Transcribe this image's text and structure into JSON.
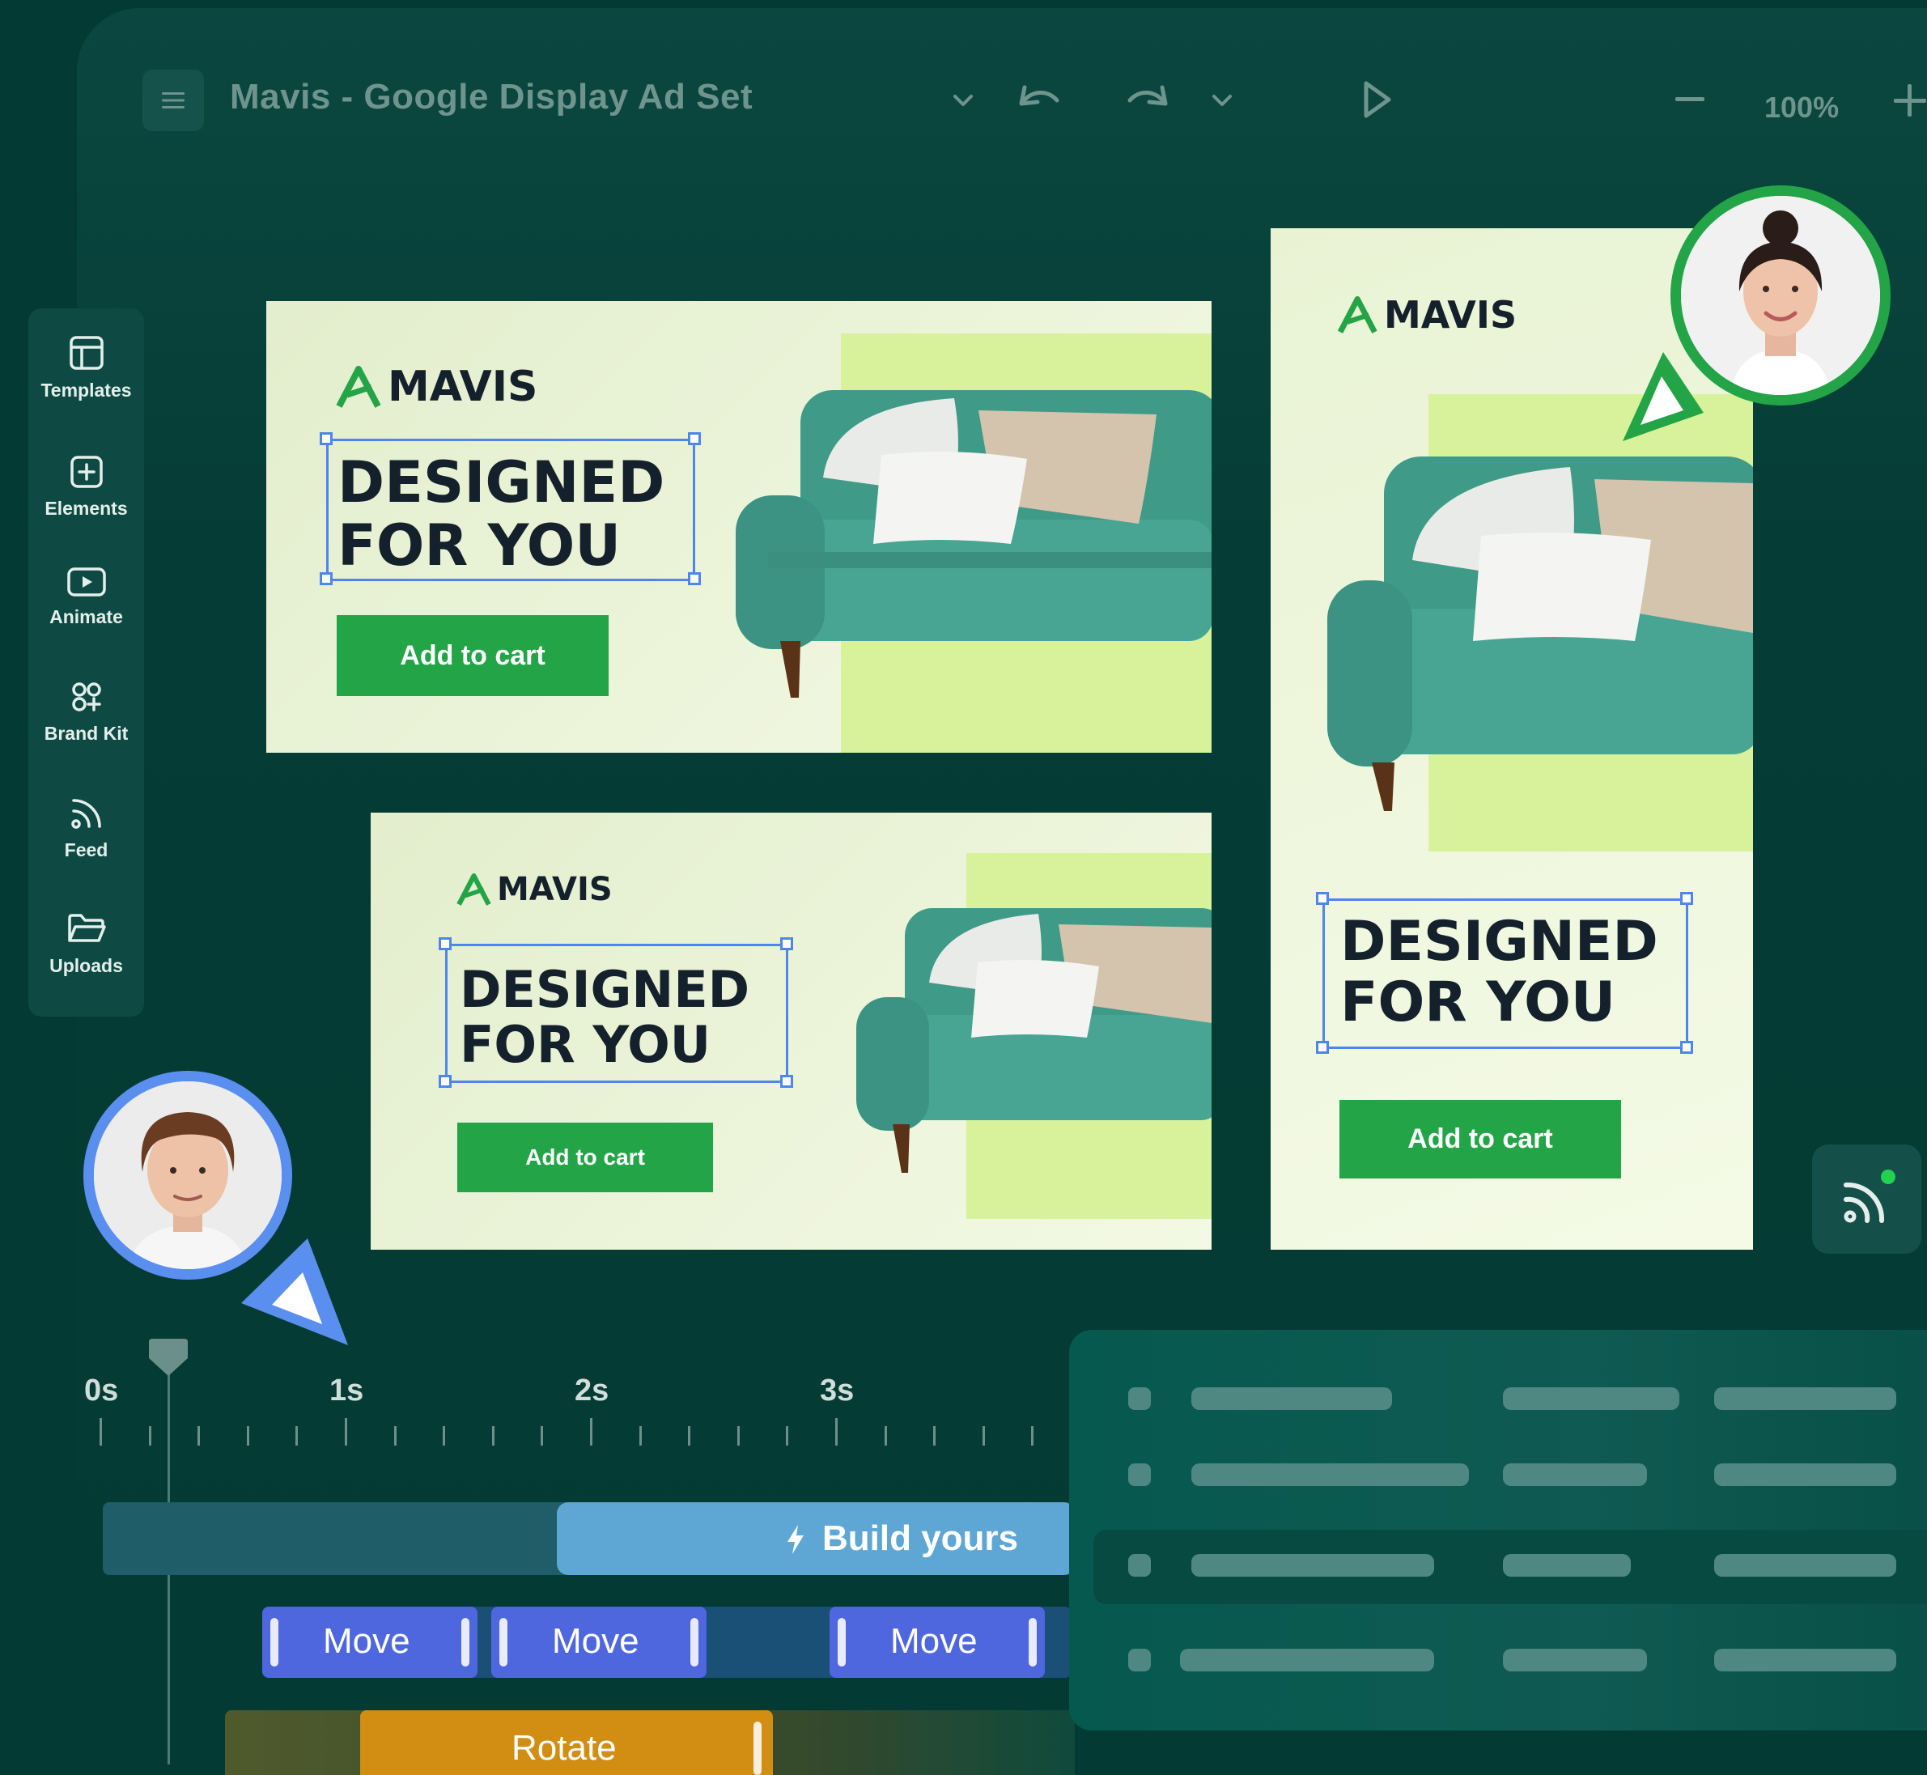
{
  "toolbar": {
    "title": "Mavis - Google Display Ad Set",
    "zoom": "100%"
  },
  "sidebar": {
    "items": [
      {
        "label": "Templates",
        "icon": "template-icon"
      },
      {
        "label": "Elements",
        "icon": "plus-square-icon"
      },
      {
        "label": "Animate",
        "icon": "play-square-icon"
      },
      {
        "label": "Brand Kit",
        "icon": "brand-kit-icon"
      },
      {
        "label": "Feed",
        "icon": "rss-icon"
      },
      {
        "label": "Uploads",
        "icon": "folder-icon"
      }
    ]
  },
  "ads": {
    "brand": "MAVIS",
    "headline_line1": "DESIGNED",
    "headline_line2": "FOR YOU",
    "cta": "Add to cart"
  },
  "timeline": {
    "ticks": [
      "0s",
      "1s",
      "2s",
      "3s"
    ],
    "build_label": "Build yours",
    "move_label": "Move",
    "rotate_label": "Rotate"
  },
  "colors": {
    "background": "#033a33",
    "accent_green": "#22a447",
    "selection_blue": "#4d86ee",
    "move_clip": "#4f67de",
    "rotate_clip": "#d18e13"
  }
}
